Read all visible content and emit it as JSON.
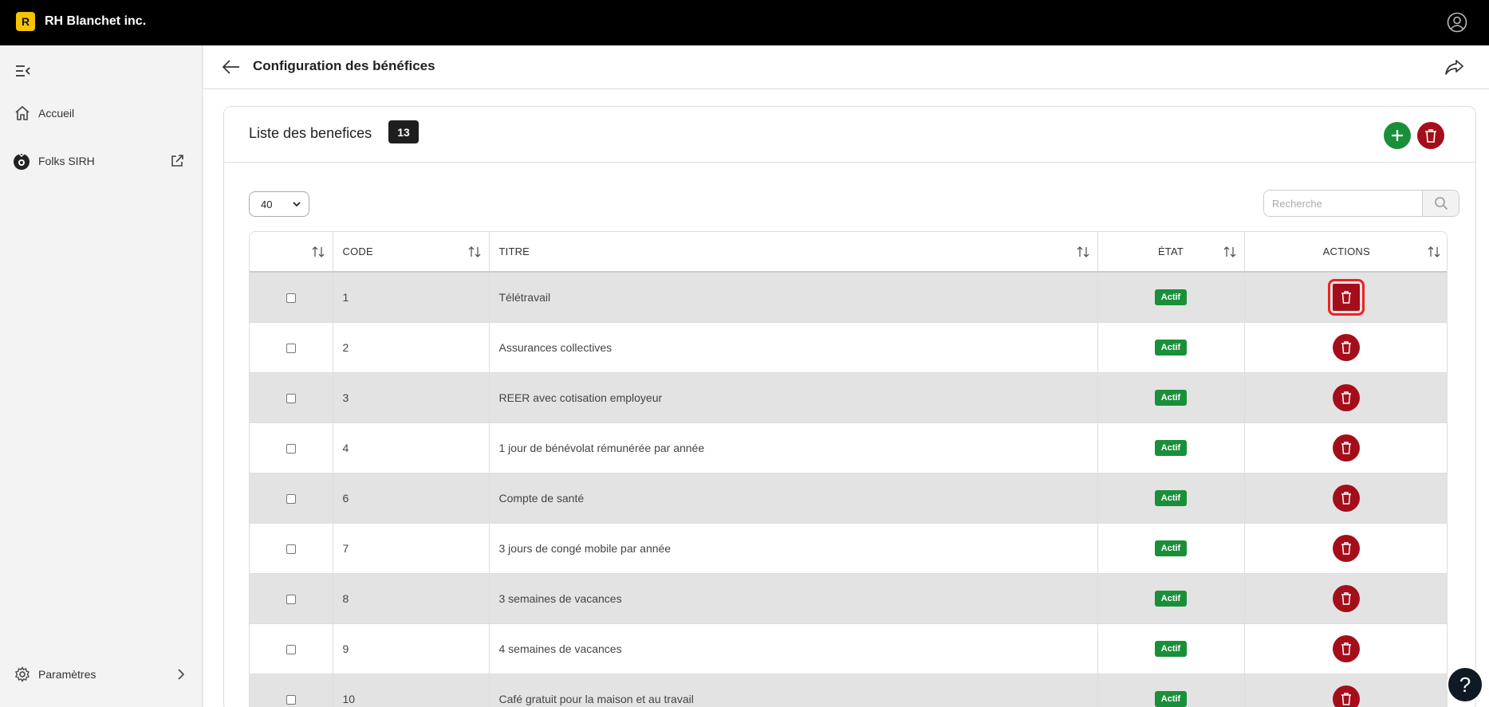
{
  "topbar": {
    "logo_letter": "R",
    "company": "RH Blanchet inc.",
    "icons": {
      "user": "user-circle-icon"
    }
  },
  "sidebar": {
    "items": [
      {
        "label": "Accueil",
        "icon": "home-icon"
      },
      {
        "label": "Folks SIRH",
        "icon": "folks-logo-icon",
        "trailing": "external-link-icon"
      },
      {
        "label": "Paramètres",
        "icon": "gear-icon",
        "trailing": "chevron-right-icon"
      }
    ]
  },
  "header": {
    "title": "Configuration des bénéfices"
  },
  "card": {
    "title": "Liste des benefices",
    "count": "13",
    "page_size": "40",
    "search_placeholder": "Recherche"
  },
  "table": {
    "columns": [
      "",
      "CODE",
      "TITRE",
      "ÉTAT",
      "ACTIONS"
    ],
    "rows": [
      {
        "code": "1",
        "title": "Télétravail",
        "state": "Actif"
      },
      {
        "code": "2",
        "title": "Assurances collectives",
        "state": "Actif"
      },
      {
        "code": "3",
        "title": "REER avec cotisation employeur",
        "state": "Actif"
      },
      {
        "code": "4",
        "title": "1 jour de bénévolat rémunérée par année",
        "state": "Actif"
      },
      {
        "code": "6",
        "title": "Compte de santé",
        "state": "Actif"
      },
      {
        "code": "7",
        "title": "3 jours de congé mobile par année",
        "state": "Actif"
      },
      {
        "code": "8",
        "title": "3 semaines de vacances",
        "state": "Actif"
      },
      {
        "code": "9",
        "title": "4 semaines de vacances",
        "state": "Actif"
      },
      {
        "code": "10",
        "title": "Café gratuit pour la maison et au travail",
        "state": "Actif"
      }
    ]
  },
  "help": {
    "label": "?"
  },
  "colors": {
    "accent_green": "#1a8f3a",
    "danger_red": "#a40e1a",
    "logo_yellow": "#f5c400"
  }
}
